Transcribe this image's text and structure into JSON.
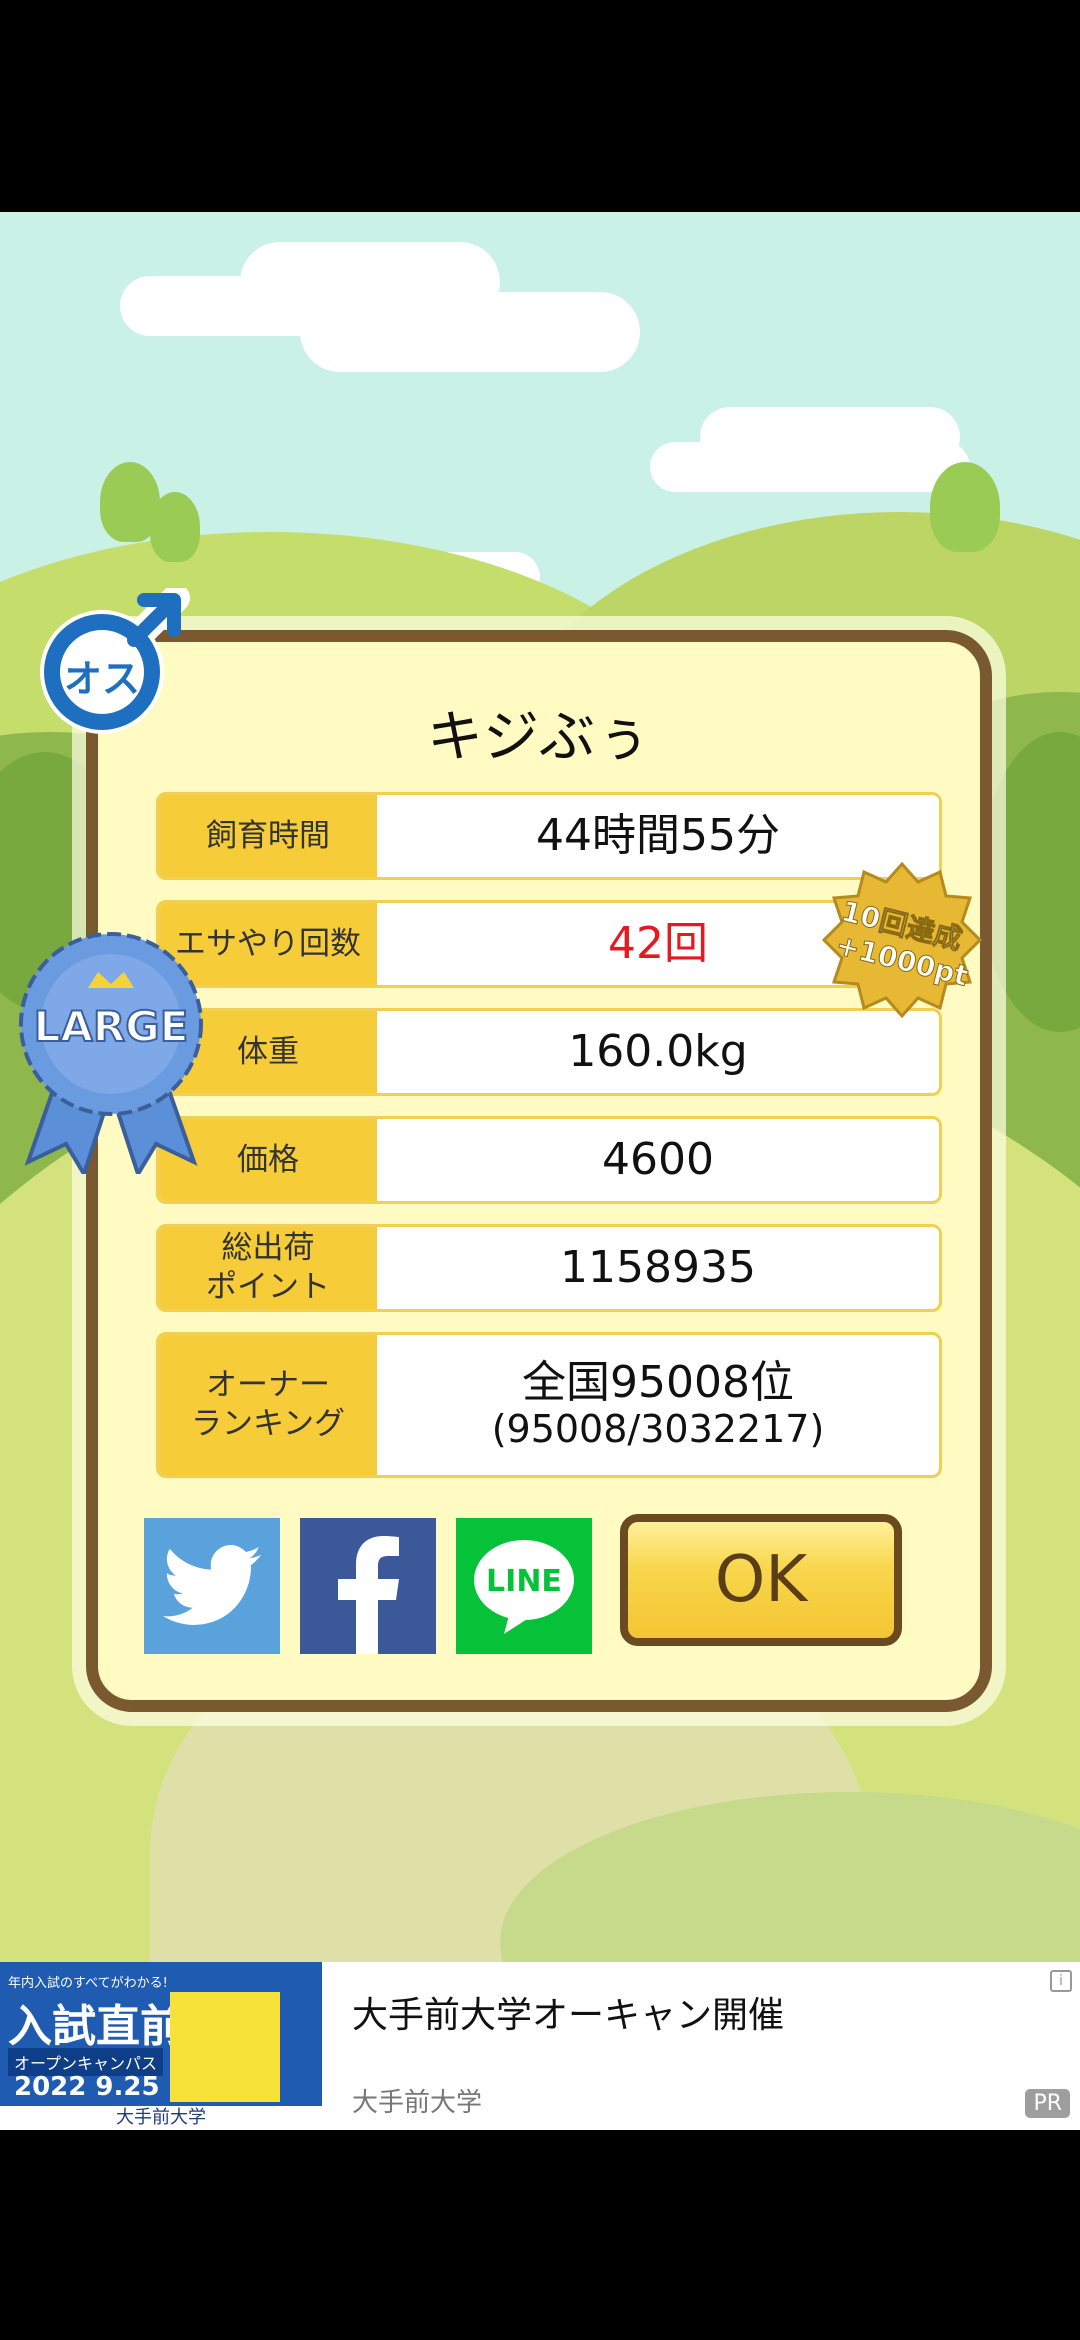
{
  "dialog": {
    "pet_name": "キジぶぅ",
    "rows": [
      {
        "label": "飼育時間",
        "value": "44時間55分",
        "color": "#111111"
      },
      {
        "label": "エサやり回数",
        "value": "42回",
        "color": "#e5191f"
      },
      {
        "label": "体重",
        "value": "160.0kg",
        "color": "#111111"
      },
      {
        "label": "価格",
        "value": "4600",
        "color": "#111111"
      },
      {
        "label": "総出荷\nポイント",
        "value": "1158935",
        "color": "#111111"
      },
      {
        "label": "オーナー\nランキング",
        "value": "全国95008位",
        "sub": "(95008/3032217)",
        "color": "#111111"
      }
    ],
    "ok_label": "OK",
    "social": {
      "twitter_icon": "twitter-icon",
      "facebook_icon": "facebook-icon",
      "line_label": "LINE"
    },
    "badges": {
      "gender_label": "オス",
      "size_label": "LARGE",
      "achievement_line1": "10回達成",
      "achievement_line2": "+1000pt"
    }
  },
  "ad": {
    "title": "大手前大学オーキャン開催",
    "advertiser": "大手前大学",
    "pr_label": "PR",
    "info_label": "i",
    "image": {
      "top_text": "年内入試のすべてがわかる!",
      "headline": "入試直前",
      "subline": "オープンキャンパス",
      "date": "2022 9.25",
      "footer": "大手前大学"
    }
  },
  "colors": {
    "twitter": "#5aa2dc",
    "facebook": "#3b5998",
    "line": "#06c238",
    "label_bg": "#f6cc38",
    "card_border": "#7a5830",
    "card_bg": "#fffbc3"
  }
}
